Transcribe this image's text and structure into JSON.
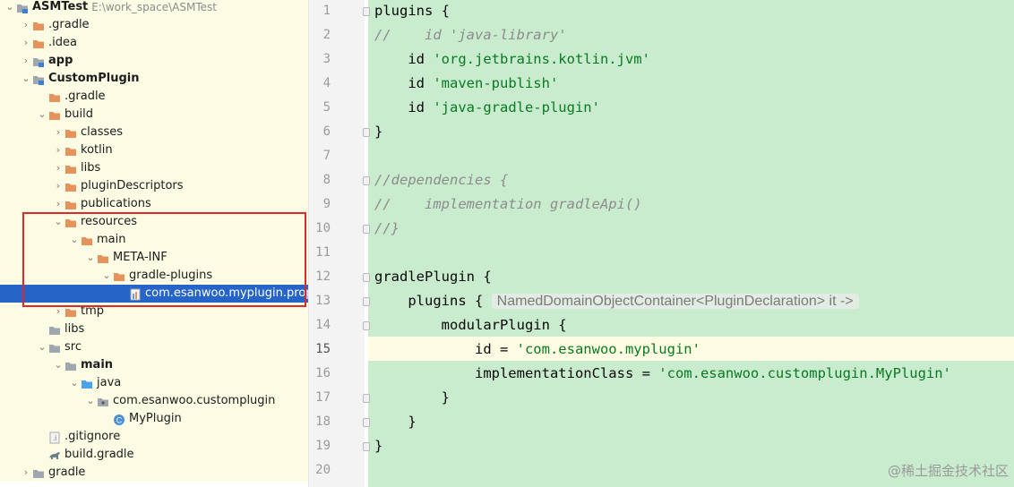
{
  "project": {
    "name": "ASMTest",
    "path": "E:\\work_space\\ASMTest"
  },
  "tree": [
    {
      "label": "ASMTest",
      "bold": true,
      "path": "E:\\work_space\\ASMTest",
      "icon": "module-icon",
      "arrow": "down"
    },
    {
      "label": ".gradle",
      "icon": "folder-icon",
      "arrow": "right"
    },
    {
      "label": ".idea",
      "icon": "folder-icon",
      "arrow": "right"
    },
    {
      "label": "app",
      "bold": true,
      "icon": "module-icon",
      "arrow": "right"
    },
    {
      "label": "CustomPlugin",
      "bold": true,
      "icon": "module-icon",
      "arrow": "down"
    },
    {
      "label": ".gradle",
      "icon": "folder-icon"
    },
    {
      "label": "build",
      "icon": "folder-icon",
      "arrow": "down"
    },
    {
      "label": "classes",
      "icon": "folder-icon",
      "arrow": "right"
    },
    {
      "label": "kotlin",
      "icon": "folder-icon",
      "arrow": "right"
    },
    {
      "label": "libs",
      "icon": "folder-icon",
      "arrow": "right"
    },
    {
      "label": "pluginDescriptors",
      "icon": "folder-icon",
      "arrow": "right"
    },
    {
      "label": "publications",
      "icon": "folder-icon",
      "arrow": "right"
    },
    {
      "label": "resources",
      "icon": "folder-icon",
      "arrow": "down"
    },
    {
      "label": "main",
      "icon": "folder-icon",
      "arrow": "down"
    },
    {
      "label": "META-INF",
      "icon": "folder-icon",
      "arrow": "down"
    },
    {
      "label": "gradle-plugins",
      "icon": "folder-icon",
      "arrow": "down"
    },
    {
      "label": "com.esanwoo.myplugin.properties",
      "icon": "properties-file-icon",
      "selected": true
    },
    {
      "label": "tmp",
      "icon": "folder-icon",
      "arrow": "right"
    },
    {
      "label": "libs",
      "icon": "plain-folder-icon"
    },
    {
      "label": "src",
      "icon": "plain-folder-icon",
      "arrow": "down"
    },
    {
      "label": "main",
      "bold": true,
      "icon": "plain-folder-icon",
      "arrow": "down"
    },
    {
      "label": "java",
      "icon": "source-folder-icon",
      "arrow": "down"
    },
    {
      "label": "com.esanwoo.customplugin",
      "icon": "package-icon",
      "arrow": "down"
    },
    {
      "label": "MyPlugin",
      "icon": "class-icon"
    },
    {
      "label": ".gitignore",
      "icon": "git-ignore-icon"
    },
    {
      "label": "build.gradle",
      "icon": "gradle-file-icon"
    },
    {
      "label": "gradle",
      "icon": "plain-folder-icon",
      "arrow": "right"
    }
  ],
  "colors": {
    "folder": "#e3935b",
    "plain_folder": "#a0a6ad",
    "source_folder": "#4aa3e8",
    "selection": "#2664c8",
    "highlight_border": "#e0282a",
    "editor_bg": "#c9ebce",
    "string": "#087a22",
    "comment": "#8c8c8c"
  },
  "editor": {
    "current_line": 15,
    "line_numbers": [
      "1",
      "2",
      "3",
      "4",
      "5",
      "6",
      "7",
      "8",
      "9",
      "10",
      "11",
      "12",
      "13",
      "14",
      "15",
      "16",
      "17",
      "18",
      "19",
      "20"
    ],
    "lines": [
      [
        {
          "t": "plugins {"
        }
      ],
      [
        {
          "t": "//    id 'java-library'",
          "c": "cm"
        }
      ],
      [
        {
          "t": "    id "
        },
        {
          "t": "'org.jetbrains.kotlin.jvm'",
          "c": "str"
        }
      ],
      [
        {
          "t": "    id "
        },
        {
          "t": "'maven-publish'",
          "c": "str"
        }
      ],
      [
        {
          "t": "    id "
        },
        {
          "t": "'java-gradle-plugin'",
          "c": "str"
        }
      ],
      [
        {
          "t": "}"
        }
      ],
      [],
      [
        {
          "t": "//dependencies {",
          "c": "cm"
        }
      ],
      [
        {
          "t": "//    implementation gradleApi()",
          "c": "cm"
        }
      ],
      [
        {
          "t": "//}",
          "c": "cm"
        }
      ],
      [],
      [
        {
          "t": "gradlePlugin {"
        }
      ],
      [
        {
          "t": "    plugins { "
        },
        {
          "t": "NamedDomainObjectContainer<PluginDeclaration> it ->",
          "c": "hint"
        }
      ],
      [
        {
          "t": "        modularPlugin {"
        }
      ],
      [
        {
          "t": "            id = "
        },
        {
          "t": "'com.esanwoo.myplugin'",
          "c": "str"
        }
      ],
      [
        {
          "t": "            implementationClass = "
        },
        {
          "t": "'com.esanwoo.customplugin.MyPlugin'",
          "c": "str"
        }
      ],
      [
        {
          "t": "        }"
        }
      ],
      [
        {
          "t": "    }"
        }
      ],
      [
        {
          "t": "}"
        }
      ],
      []
    ]
  },
  "watermark": "@稀土掘金技术社区"
}
